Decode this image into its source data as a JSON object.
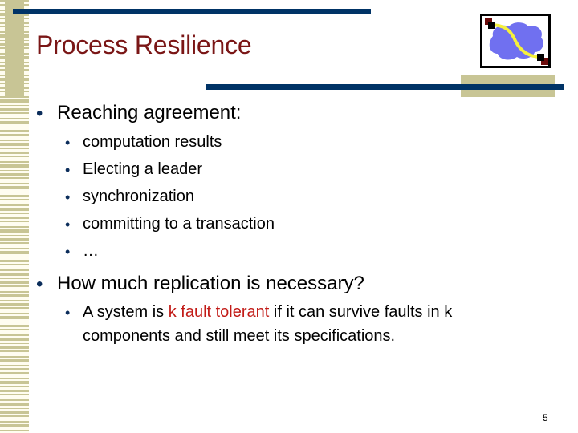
{
  "slide": {
    "title": "Process Resilience",
    "logo_icon": "network-cloud-path-icon",
    "bullets": [
      {
        "text": "Reaching agreement:",
        "children": [
          "computation results",
          "Electing a leader",
          "synchronization",
          "committing to a transaction",
          "…"
        ]
      },
      {
        "text": "How much replication is necessary?",
        "children": [
          {
            "pre": "A system is ",
            "highlight": "k fault tolerant",
            "post_line1": " if it can survive faults in k",
            "line2": "components and still meet its specifications."
          }
        ]
      }
    ],
    "bullet_glyph": "•",
    "page_number": "5"
  },
  "colors": {
    "title": "#7a1616",
    "rule": "#003366",
    "decor_tan": "#c8c595",
    "highlight": "#c21b17",
    "bullet": "#0b2d5b",
    "logo_cloud": "#7070f0",
    "logo_path": "#f5f03c",
    "logo_node_dark": "#6b0a0a"
  }
}
